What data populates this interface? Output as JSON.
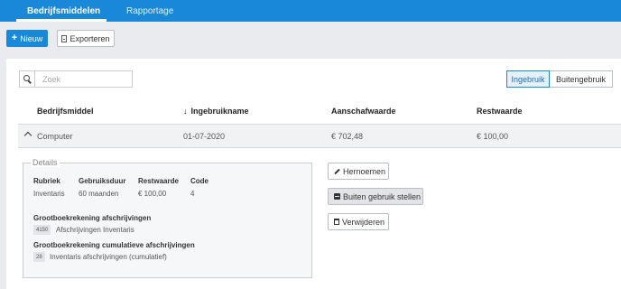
{
  "nav": {
    "tabs": [
      {
        "label": "Bedrijfsmiddelen",
        "active": true
      },
      {
        "label": "Rapportage",
        "active": false
      }
    ]
  },
  "toolbar": {
    "new_label": "Nieuw",
    "export_label": "Exporteren"
  },
  "search": {
    "placeholder": "Zoek",
    "value": ""
  },
  "filter": {
    "options": [
      "Ingebruik",
      "Buitengebruik"
    ],
    "selected": "Ingebruik"
  },
  "table": {
    "columns": [
      "Bedrijfsmiddel",
      "Ingebruikname",
      "Aanschafwaarde",
      "Restwaarde"
    ],
    "sort_column": "Ingebruikname",
    "rows": [
      {
        "name": "Computer",
        "date": "01-07-2020",
        "purchase": "€ 702,48",
        "residual": "€ 100,00",
        "expanded": true
      }
    ]
  },
  "details": {
    "legend": "Details",
    "fields": [
      {
        "label": "Rubriek",
        "value": "Inventaris"
      },
      {
        "label": "Gebruiksduur",
        "value": "60 maanden"
      },
      {
        "label": "Restwaarde",
        "value": "€ 100,00"
      },
      {
        "label": "Code",
        "value": "4"
      }
    ],
    "ledgers": [
      {
        "title": "Grootboekrekening afschrijvingen",
        "code": "4150",
        "name": "Afschrijvingen Inventaris"
      },
      {
        "title": "Grootboekrekening cumulatieve afschrijvingen",
        "code": "28",
        "name": "Inventaris afschrijvingen (cumulatief)"
      }
    ]
  },
  "actions": {
    "rename": "Hernoemen",
    "deactivate": "Buiten gebruik stellen",
    "delete": "Verwijderen"
  },
  "colors": {
    "primary": "#1a88d8",
    "row_bg": "#f1f2f4",
    "page_bg": "#e9ebee"
  }
}
